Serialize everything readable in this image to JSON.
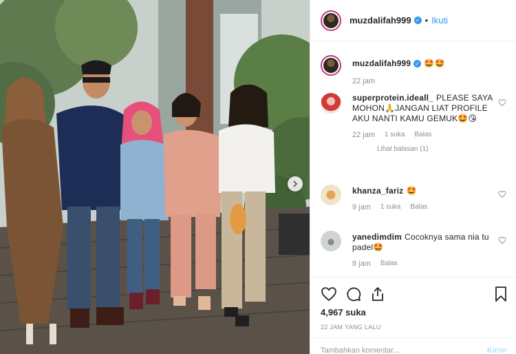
{
  "post": {
    "username": "muzdalifah999",
    "verified": true,
    "follow_label": "Ikuti",
    "dot": "•"
  },
  "caption": {
    "username": "muzdalifah999",
    "text": "🤩🤩",
    "time": "22 jam"
  },
  "comments": [
    {
      "username": "superprotein.ideall_",
      "text": "PLEASE SAYA MOHON🙏JANGAN LIAT PROFILE AKU NANTI KAMU GEMUK🤩😘",
      "time": "22 jam",
      "likes": "1 suka",
      "reply": "Balas",
      "view_replies": "Lihat balasan (1)"
    },
    {
      "username": "khanza_fariz",
      "text": "🤩",
      "time": "9 jam",
      "likes": "1 suka",
      "reply": "Balas"
    },
    {
      "username": "yanedimdim",
      "text": "Cocoknya sama nia tu padel🤩",
      "time": "8 jam",
      "reply": "Balas"
    }
  ],
  "likes_count": "4,967 suka",
  "timestamp": "22 JAM YANG LALU",
  "add_comment": {
    "placeholder": "Tambahkan komentar...",
    "post_label": "Kirim"
  },
  "icons": {
    "like": "heart-icon",
    "comment": "comment-icon",
    "share": "share-icon",
    "save": "bookmark-icon",
    "next": "chevron-right-icon"
  },
  "colors": {
    "link": "#3897f0",
    "muted": "#8e8e8e",
    "text": "#262626",
    "border": "#efefef"
  }
}
